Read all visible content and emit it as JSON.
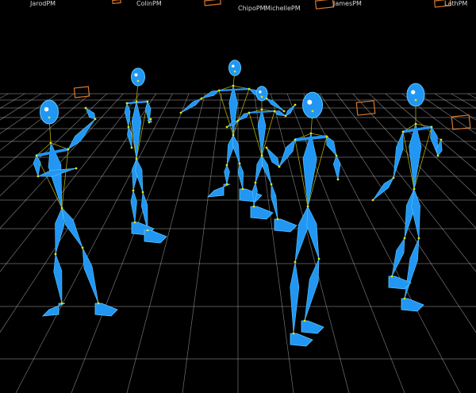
{
  "viewport": {
    "background": "#000000",
    "grid_color": "#d0d0d0",
    "bone_color": "#2196f3",
    "bone_light": "#5ec8ff",
    "marker_color": "#e8e000",
    "camera_color": "#d9782a"
  },
  "performer_labels": [
    "JarodPM",
    "ColinPM",
    "ChipoPM",
    "MichellePM",
    "JamesPM",
    "LathPM"
  ]
}
